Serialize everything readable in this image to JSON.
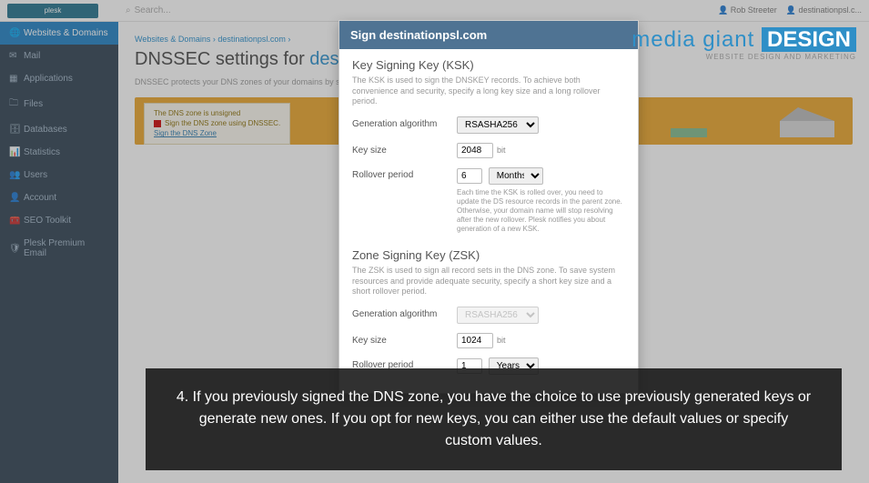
{
  "topbar": {
    "logo": "plesk",
    "search_placeholder": "Search...",
    "user": "Rob Streeter",
    "subscription": "destinationpsl.c..."
  },
  "sidebar": {
    "items": [
      {
        "icon": "🌐",
        "label": "Websites & Domains",
        "active": true
      },
      {
        "icon": "✉",
        "label": "Mail"
      },
      {
        "icon": "▦",
        "label": "Applications"
      },
      {
        "icon": "🗀",
        "label": "Files"
      },
      {
        "icon": "🗄",
        "label": "Databases"
      },
      {
        "icon": "📊",
        "label": "Statistics"
      },
      {
        "icon": "👥",
        "label": "Users"
      },
      {
        "icon": "👤",
        "label": "Account"
      },
      {
        "icon": "🧰",
        "label": "SEO Toolkit"
      },
      {
        "icon": "🛡",
        "label": "Plesk Premium Email"
      }
    ]
  },
  "breadcrumb": "Websites & Domains › destinationpsl.com ›",
  "page_title_prefix": "DNSSEC settings for ",
  "page_title_domain": "destinationpsl.com",
  "page_desc": "DNSSEC protects your DNS zones of your domains by signing...",
  "banner": {
    "line1": "The DNS zone is unsigned",
    "line2": "Sign the DNS zone using DNSSEC.",
    "button": "Sign the DNS Zone"
  },
  "modal": {
    "title": "Sign destinationpsl.com",
    "ksk": {
      "heading": "Key Signing Key (KSK)",
      "desc": "The KSK is used to sign the DNSKEY records. To achieve both convenience and security, specify a long key size and a long rollover period.",
      "algo_label": "Generation algorithm",
      "algo_value": "RSASHA256",
      "size_label": "Key size",
      "size_value": "2048",
      "size_unit": "bit",
      "rollover_label": "Rollover period",
      "rollover_value": "6",
      "rollover_unit": "Months",
      "rollover_note": "Each time the KSK is rolled over, you need to update the DS resource records in the parent zone. Otherwise, your domain name will stop resolving after the new rollover. Plesk notifies you about generation of a new KSK."
    },
    "zsk": {
      "heading": "Zone Signing Key (ZSK)",
      "desc": "The ZSK is used to sign all record sets in the DNS zone. To save system resources and provide adequate security, specify a short key size and a short rollover period.",
      "algo_label": "Generation algorithm",
      "algo_value": "RSASHA256",
      "size_label": "Key size",
      "size_value": "1024",
      "size_unit": "bit",
      "rollover_label": "Rollover period",
      "rollover_value": "1",
      "rollover_unit": "Years"
    }
  },
  "watermark": {
    "line1a": "media giant ",
    "line1b": "DESIGN",
    "line2": "WEBSITE DESIGN AND MARKETING"
  },
  "caption": "4. If you previously signed the DNS zone, you have the choice to use previously generated keys or generate new ones. If you opt for new keys, you can either use the default values or specify custom values."
}
